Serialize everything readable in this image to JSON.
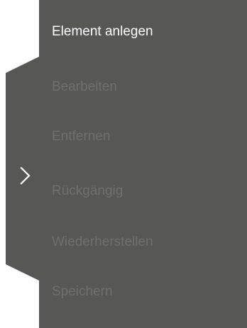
{
  "colors": {
    "panel_background": "#575756",
    "enabled_text": "#ffffff",
    "disabled_text": "#6f6f6f",
    "chevron": "#ffffff"
  },
  "toggle": {
    "icon": "chevron-right-icon"
  },
  "menu": {
    "items": [
      {
        "label": "Element anlegen",
        "enabled": true
      },
      {
        "label": "Bearbeiten",
        "enabled": false
      },
      {
        "label": "Entfernen",
        "enabled": false
      },
      {
        "label": "Rückgängig",
        "enabled": false
      },
      {
        "label": "Wiederherstellen",
        "enabled": false
      },
      {
        "label": "Speichern",
        "enabled": false
      }
    ]
  }
}
